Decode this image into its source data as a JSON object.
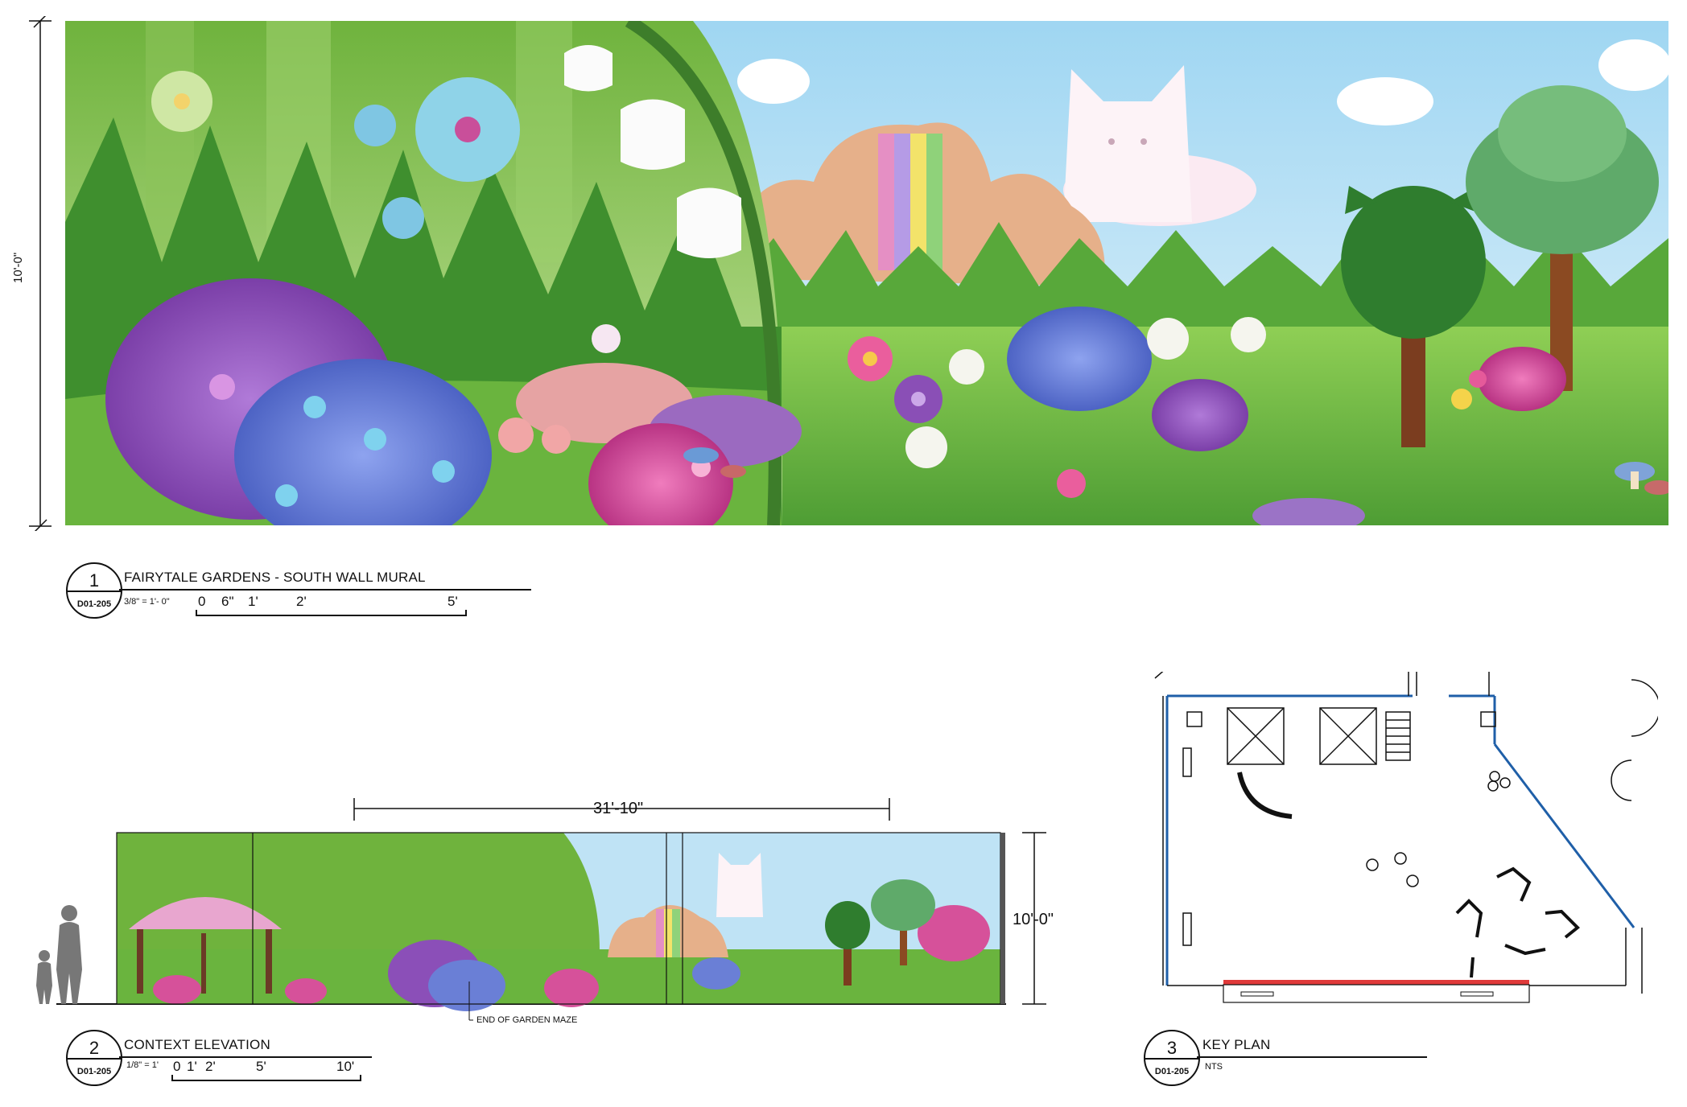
{
  "drawing1": {
    "number": "1",
    "sheet": "D01-205",
    "title": "FAIRYTALE GARDENS - SOUTH WALL MURAL",
    "scale": "3/8\" = 1'- 0\"",
    "scale_ticks": [
      "0",
      "6\"",
      "1'",
      "2'",
      "5'"
    ],
    "height_dim": "10'-0\""
  },
  "drawing2": {
    "number": "2",
    "sheet": "D01-205",
    "title": "CONTEXT ELEVATION",
    "scale": "1/8\" = 1'",
    "scale_ticks": [
      "0",
      "1'",
      "2'",
      "5'",
      "10'"
    ],
    "width_dim": "31'-10\"",
    "height_dim": "10'-0\"",
    "callout": "END OF GARDEN MAZE"
  },
  "drawing3": {
    "number": "3",
    "sheet": "D01-205",
    "title": "KEY PLAN",
    "scale": "NTS"
  },
  "colors": {
    "sky": "#bfe3f5",
    "grass": "#7cc24a",
    "dark_grass": "#3f8f2e",
    "purple_bush": "#8b4fb8",
    "blue_bush": "#6a7fd6",
    "pink_bush": "#d6519a",
    "hill": "#e6b08a",
    "plan_wall": "#1f5fa8",
    "plan_highlight": "#e03a3a"
  }
}
